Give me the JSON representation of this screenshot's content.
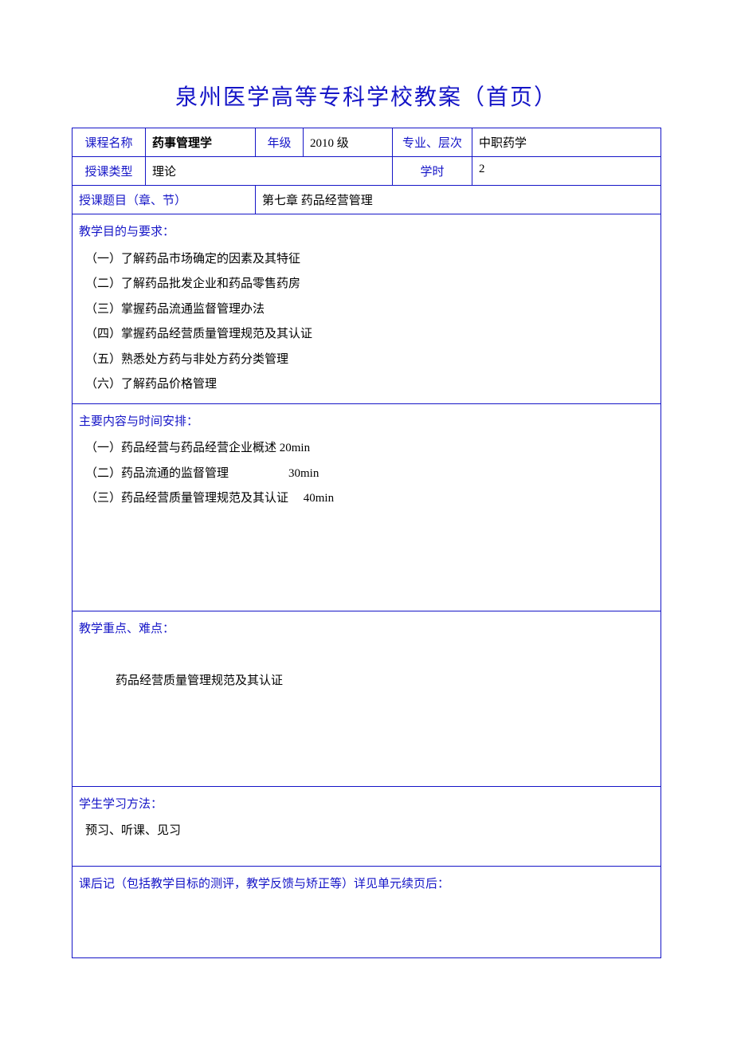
{
  "title": "泉州医学高等专科学校教案（首页）",
  "row1": {
    "label_course": "课程名称",
    "course": "药事管理学",
    "label_grade": "年级",
    "grade": "2010 级",
    "label_major": "专业、层次",
    "major": "中职药学"
  },
  "row2": {
    "label_type": "授课类型",
    "type": "理论",
    "label_hours": "学时",
    "hours": "2"
  },
  "row3": {
    "label_topic": "授课题目（章、节）",
    "topic": "第七章 药品经营管理"
  },
  "objectives": {
    "header": "教学目的与要求：",
    "items": [
      "（一）了解药品市场确定的因素及其特征",
      "（二）了解药品批发企业和药品零售药房",
      "（三）掌握药品流通监督管理办法",
      "（四）掌握药品经营质量管理规范及其认证",
      "（五）熟悉处方药与非处方药分类管理",
      "（六）了解药品价格管理"
    ]
  },
  "contents": {
    "header": "主要内容与时间安排：",
    "items": [
      "（一）药品经营与药品经营企业概述 20min",
      "（二）药品流通的监督管理     30min",
      "（三）药品经营质量管理规范及其认证  40min"
    ]
  },
  "keypoints": {
    "header": "教学重点、难点：",
    "text": "药品经营质量管理规范及其认证"
  },
  "methods": {
    "header": "学生学习方法：",
    "text": "预习、听课、见习"
  },
  "postnote": {
    "header": "课后记（包括教学目标的测评，教学反馈与矫正等）详见单元续页后："
  }
}
